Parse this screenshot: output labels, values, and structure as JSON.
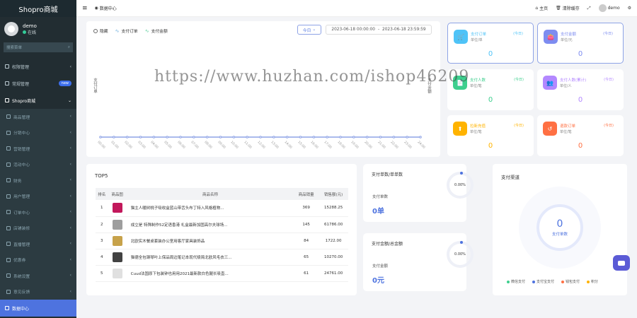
{
  "brand": "Shopro商城",
  "user": {
    "name": "demo",
    "status": "在线"
  },
  "sidebar": {
    "search_placeholder": "搜索菜单",
    "items": [
      {
        "label": "权限管理",
        "kind": "collapsed"
      },
      {
        "label": "常规管理",
        "badge": "new"
      },
      {
        "label": "Shopro商城",
        "kind": "expanded"
      },
      {
        "label": "商品管理",
        "kind": "sub"
      },
      {
        "label": "分销中心",
        "kind": "sub"
      },
      {
        "label": "营销管理",
        "kind": "sub"
      },
      {
        "label": "活动中心",
        "kind": "sub"
      },
      {
        "label": "财务",
        "kind": "sub"
      },
      {
        "label": "用户管理",
        "kind": "sub"
      },
      {
        "label": "订单中心",
        "kind": "sub"
      },
      {
        "label": "店铺装修",
        "kind": "sub"
      },
      {
        "label": "直播管理",
        "kind": "sub"
      },
      {
        "label": "优惠券",
        "kind": "sub"
      },
      {
        "label": "系统设置",
        "kind": "sub"
      },
      {
        "label": "意见反馈",
        "kind": "sub"
      },
      {
        "label": "数据中心",
        "kind": "active"
      }
    ]
  },
  "header": {
    "tab": "数据中心",
    "home": "主页",
    "clear_cache": "清除缓存",
    "username": "demo"
  },
  "chart": {
    "legend": [
      "隐藏",
      "支付订单",
      "支付金额"
    ],
    "period": "今日",
    "date_start": "2023-06-18 00:00:00",
    "date_sep": "-",
    "date_end": "2023-06-18 23:59:59",
    "ylabel_left": "支付订单",
    "ylabel_right": "支付金额"
  },
  "chart_data": {
    "type": "line",
    "x": [
      "00:00",
      "01:00",
      "02:00",
      "03:00",
      "04:00",
      "05:00",
      "06:00",
      "07:00",
      "08:00",
      "09:00",
      "10:00",
      "11:00",
      "12:00",
      "13:00",
      "14:00",
      "15:00",
      "16:00",
      "17:00",
      "18:00",
      "19:00",
      "20:00",
      "21:00",
      "22:00",
      "23:00",
      "24:00"
    ],
    "series": [
      {
        "name": "支付订单",
        "values": [
          0,
          0,
          0,
          0,
          0,
          0,
          0,
          0,
          0,
          0,
          0,
          0,
          0,
          0,
          0,
          0,
          0,
          0,
          0,
          0,
          0,
          0,
          0,
          0,
          0
        ]
      },
      {
        "name": "支付金额",
        "values": [
          0,
          0,
          0,
          0,
          0,
          0,
          0,
          0,
          0,
          0,
          0,
          0,
          0,
          0,
          0,
          0,
          0,
          0,
          0,
          0,
          0,
          0,
          0,
          0,
          0
        ]
      }
    ],
    "line_color": "#8ea3e6"
  },
  "stats": [
    {
      "title": "支付订单",
      "unit": "单位/单",
      "period": "(今日)",
      "value": "0",
      "color": "#4fc3f7",
      "icon": "cart-icon"
    },
    {
      "title": "支付金额",
      "unit": "单位/元",
      "period": "(今日)",
      "value": "0",
      "color": "#7d8cf0",
      "icon": "wallet-icon"
    },
    {
      "title": "支付人数",
      "unit": "单位/笔",
      "period": "(今日)",
      "value": "0",
      "color": "#3ecf8e",
      "icon": "orders-icon"
    },
    {
      "title": "支付人数(累计)",
      "unit": "单位/人",
      "period": "(今日)",
      "value": "0",
      "color": "#b388ff",
      "icon": "users-icon"
    },
    {
      "title": "拉新充值",
      "unit": "单位/笔",
      "period": "(今日)",
      "value": "0",
      "color": "#ffb300",
      "icon": "recharge-icon"
    },
    {
      "title": "退款订单",
      "unit": "单位/笔",
      "period": "(今日)",
      "value": "0",
      "color": "#ff7043",
      "icon": "refund-icon"
    }
  ],
  "top5": {
    "title": "TOP5",
    "headers": [
      "排名",
      "商品图",
      "商品名称",
      "商品销量",
      "销售额(元)"
    ],
    "rows": [
      {
        "rank": "1",
        "name": "猫主人暖树桃子吸收盒蓝山带舌头布丁特入风格植物...",
        "sales": "369",
        "amount": "15288.25",
        "thumb": "#c2185b"
      },
      {
        "rank": "2",
        "name": "成立是 特殊制作52定语香港 礼盒最新加固高尔夫球场...",
        "sales": "145",
        "amount": "61786.00",
        "thumb": "#9e9e9e"
      },
      {
        "rank": "3",
        "name": "北欧实木餐桌套装办公室用客厅家具装饰品",
        "sales": "84",
        "amount": "1722.00",
        "thumb": "#c7a24a"
      },
      {
        "rank": "4",
        "name": "猫德全包钢琴叶上保品周边笔记本现代极简北欧风毛衣三...",
        "sales": "65",
        "amount": "10270.00",
        "thumb": "#424242"
      },
      {
        "rank": "5",
        "name": "Cuud法国原下包装钟也用用2021最新款白色腿长吸直...",
        "sales": "61",
        "amount": "24761.00",
        "thumb": "#e0e0e0"
      }
    ]
  },
  "pay_count": {
    "title": "支付单数/单单数",
    "label": "支付单数",
    "value": "0单",
    "percent": "0.00%"
  },
  "pay_amount": {
    "title": "支付金额/总金额",
    "label": "支付金额",
    "value": "0元",
    "percent": "0.00%"
  },
  "channel": {
    "title": "支付渠道",
    "count": "0",
    "count_label": "支付单数",
    "legend": [
      {
        "label": "微信支付",
        "color": "#3ecf8e"
      },
      {
        "label": "支付宝支付",
        "color": "#4e73df"
      },
      {
        "label": "钱包支付",
        "color": "#ff7043"
      },
      {
        "label": "积分",
        "color": "#ffb300"
      }
    ]
  },
  "watermark": "https://www.huzhan.com/ishop46209"
}
